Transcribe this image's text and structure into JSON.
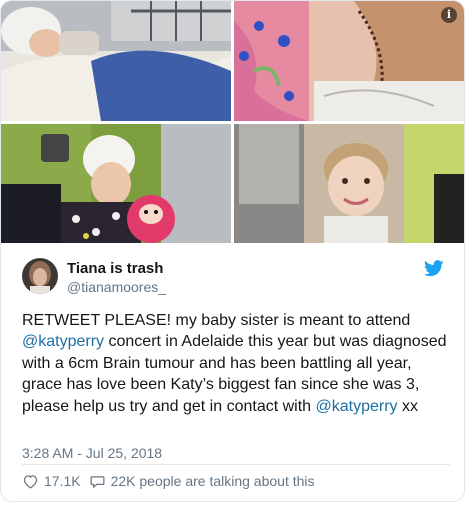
{
  "tweet": {
    "user_name": "Tiana is trash",
    "handle": "@tianamoores_",
    "text_parts": [
      "RETWEET PLEASE! my baby sister is meant to attend ",
      "@katyperry",
      " concert in Adelaide this year but was diagnosed with a 6cm Brain tumour and has been battling all year, grace has love been Katy’s biggest fan since she was 3, please help us try and get in contact with ",
      "@katyperry",
      " xx"
    ],
    "timestamp": "3:28 AM - Jul 25, 2018",
    "like_count": "17.1K",
    "talking_text": "22K people are talking about this"
  },
  "icons": {
    "info": "info-icon",
    "brand": "twitter-bird-icon",
    "like": "heart-icon",
    "reply": "speech-bubble-icon"
  },
  "colors": {
    "link": "#1b6fa3",
    "brand": "#1da1f2",
    "muted": "#657786",
    "text": "#14171a"
  },
  "info_glyph": "i"
}
